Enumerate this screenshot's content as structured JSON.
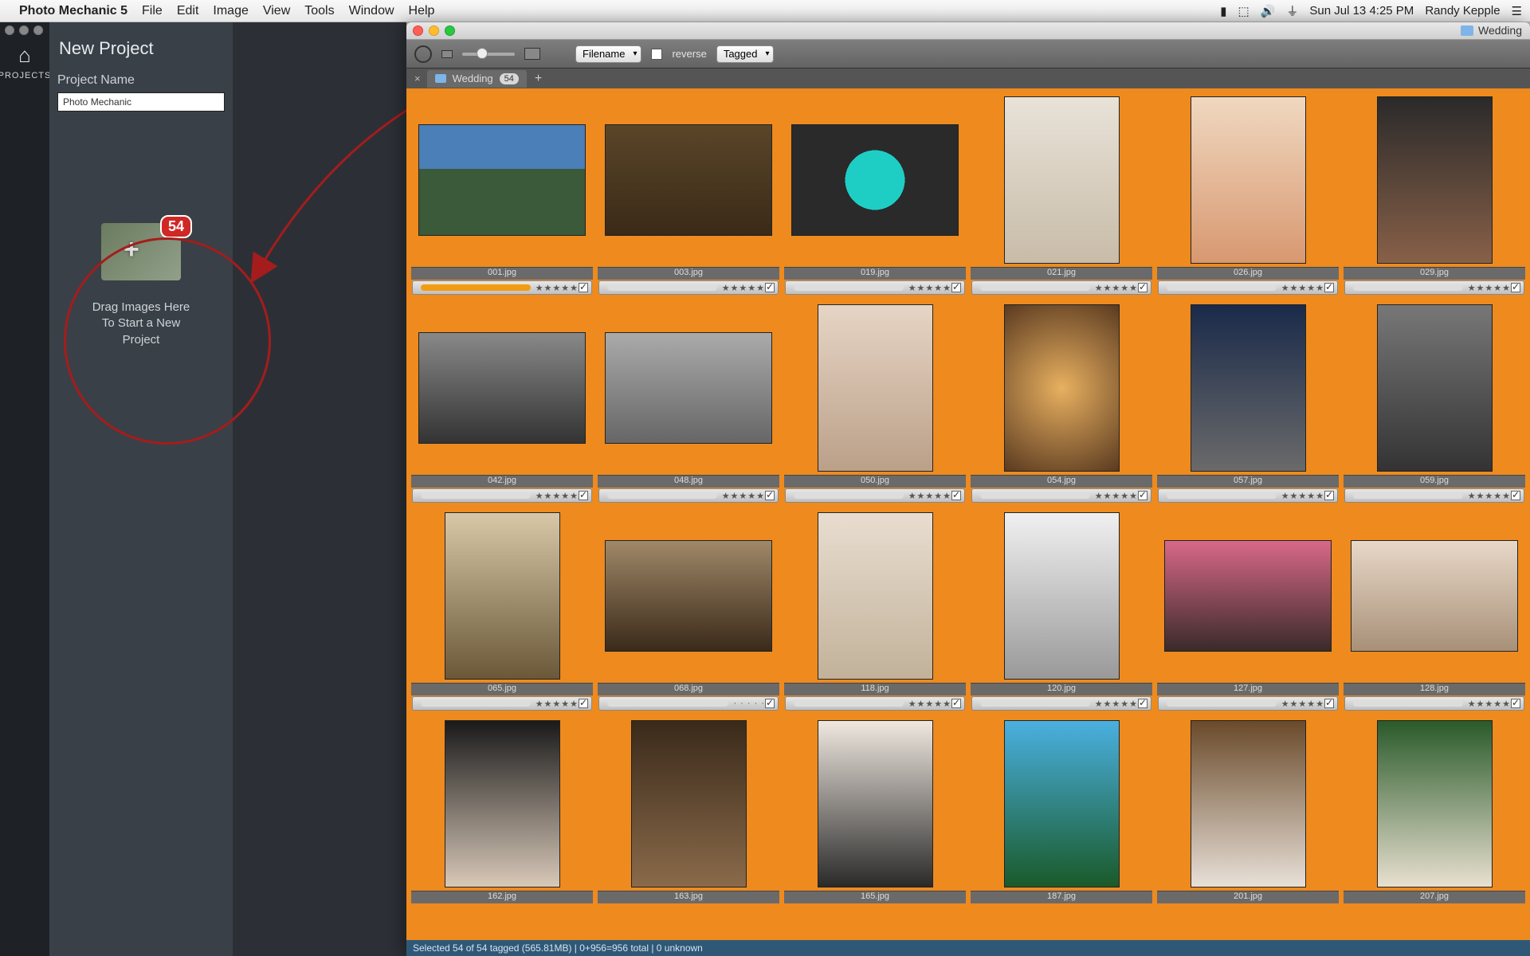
{
  "menubar": {
    "app": "Photo Mechanic 5",
    "items": [
      "File",
      "Edit",
      "Image",
      "View",
      "Tools",
      "Window",
      "Help"
    ],
    "clock": "Sun Jul 13  4:25 PM",
    "user": "Randy Kepple"
  },
  "leftapp": {
    "rail_label": "PROJECTS",
    "title": "New Project",
    "field_label": "Project Name",
    "field_value": "Photo Mechanic",
    "drop_badge": "54",
    "drop_text_l1": "Drag Images Here",
    "drop_text_l2": "To Start a New",
    "drop_text_l3": "Project"
  },
  "pm": {
    "folder": "Wedding",
    "sort_select": "Filename",
    "reverse_label": "reverse",
    "filter_select": "Tagged",
    "tab_name": "Wedding",
    "tab_count": "54",
    "status": "Selected 54 of 54 tagged (565.81MB) | 0+956=956 total | 0 unknown",
    "thumbs": [
      {
        "file": "001.jpg",
        "shape": "land",
        "cls": "p1",
        "stars": "★★★★★",
        "prog": 100
      },
      {
        "file": "003.jpg",
        "shape": "land",
        "cls": "p2",
        "stars": "★★★★★",
        "prog": 0
      },
      {
        "file": "019.jpg",
        "shape": "land",
        "cls": "p3",
        "stars": "★★★★★",
        "prog": 0
      },
      {
        "file": "021.jpg",
        "shape": "port",
        "cls": "p4",
        "stars": "★★★★★",
        "prog": 0
      },
      {
        "file": "026.jpg",
        "shape": "port",
        "cls": "p5",
        "stars": "★★★★★",
        "prog": 0
      },
      {
        "file": "029.jpg",
        "shape": "port",
        "cls": "p6",
        "stars": "★★★★★",
        "prog": 0
      },
      {
        "file": "042.jpg",
        "shape": "land",
        "cls": "p7 bw",
        "stars": "★★★★★",
        "prog": 0
      },
      {
        "file": "048.jpg",
        "shape": "land",
        "cls": "p8 bw",
        "stars": "★★★★★",
        "prog": 0
      },
      {
        "file": "050.jpg",
        "shape": "port",
        "cls": "p9",
        "stars": "★★★★★",
        "prog": 0
      },
      {
        "file": "054.jpg",
        "shape": "port",
        "cls": "p10",
        "stars": "★★★★★",
        "prog": 0
      },
      {
        "file": "057.jpg",
        "shape": "port",
        "cls": "p11",
        "stars": "★★★★★",
        "prog": 0
      },
      {
        "file": "059.jpg",
        "shape": "port",
        "cls": "p12 bw",
        "stars": "★★★★★",
        "prog": 0
      },
      {
        "file": "065.jpg",
        "shape": "port",
        "cls": "p13",
        "stars": "★★★★★",
        "prog": 0
      },
      {
        "file": "068.jpg",
        "shape": "land",
        "cls": "p14",
        "stars": "· · · · ·",
        "prog": 0
      },
      {
        "file": "118.jpg",
        "shape": "port",
        "cls": "p15",
        "stars": "★★★★★",
        "prog": 0
      },
      {
        "file": "120.jpg",
        "shape": "port",
        "cls": "p16",
        "stars": "★★★★★",
        "prog": 0
      },
      {
        "file": "127.jpg",
        "shape": "land",
        "cls": "p17",
        "stars": "★★★★★",
        "prog": 0
      },
      {
        "file": "128.jpg",
        "shape": "land",
        "cls": "p18",
        "stars": "★★★★★",
        "prog": 0
      },
      {
        "file": "162.jpg",
        "shape": "port",
        "cls": "p19",
        "stars": "",
        "prog": 0
      },
      {
        "file": "163.jpg",
        "shape": "port",
        "cls": "p20",
        "stars": "",
        "prog": 0
      },
      {
        "file": "165.jpg",
        "shape": "port",
        "cls": "p21",
        "stars": "",
        "prog": 0
      },
      {
        "file": "187.jpg",
        "shape": "port",
        "cls": "p22",
        "stars": "",
        "prog": 0
      },
      {
        "file": "201.jpg",
        "shape": "port",
        "cls": "p23",
        "stars": "",
        "prog": 0
      },
      {
        "file": "207.jpg",
        "shape": "port",
        "cls": "p24",
        "stars": "",
        "prog": 0
      }
    ]
  }
}
